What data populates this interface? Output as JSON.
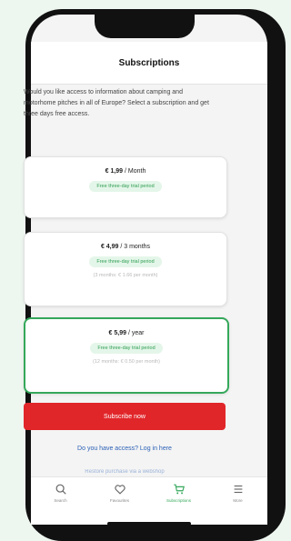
{
  "header": {
    "title": "Subscriptions"
  },
  "intro": "Would you like access to information about camping and motorhome pitches in all of Europe? Select a subscription and get three days free access.",
  "plans": [
    {
      "price": "€ 1,99",
      "period": " / Month",
      "trial": "Free three-day trial period",
      "note": ""
    },
    {
      "price": "€ 4,99",
      "period": " / 3 months",
      "trial": "Free three-day trial period",
      "note": "(3 months: € 1.66 per month)"
    },
    {
      "price": "€ 5,99",
      "period": " / year",
      "trial": "Free three-day trial period",
      "note": "(12 months: € 0.50 per month)"
    }
  ],
  "subscribe_label": "Subscribe now",
  "login_text": "Do you have access? Log in here",
  "login_text_2": "Restore purchase via a webshop",
  "tabs": [
    {
      "label": "Search",
      "icon": "search-icon"
    },
    {
      "label": "Favourites",
      "icon": "heart-icon"
    },
    {
      "label": "Subscriptions",
      "icon": "cart-icon"
    },
    {
      "label": "More",
      "icon": "menu-icon"
    }
  ],
  "colors": {
    "accent": "#35a85b",
    "primary_button": "#e1262a",
    "link": "#2a5fb5"
  }
}
